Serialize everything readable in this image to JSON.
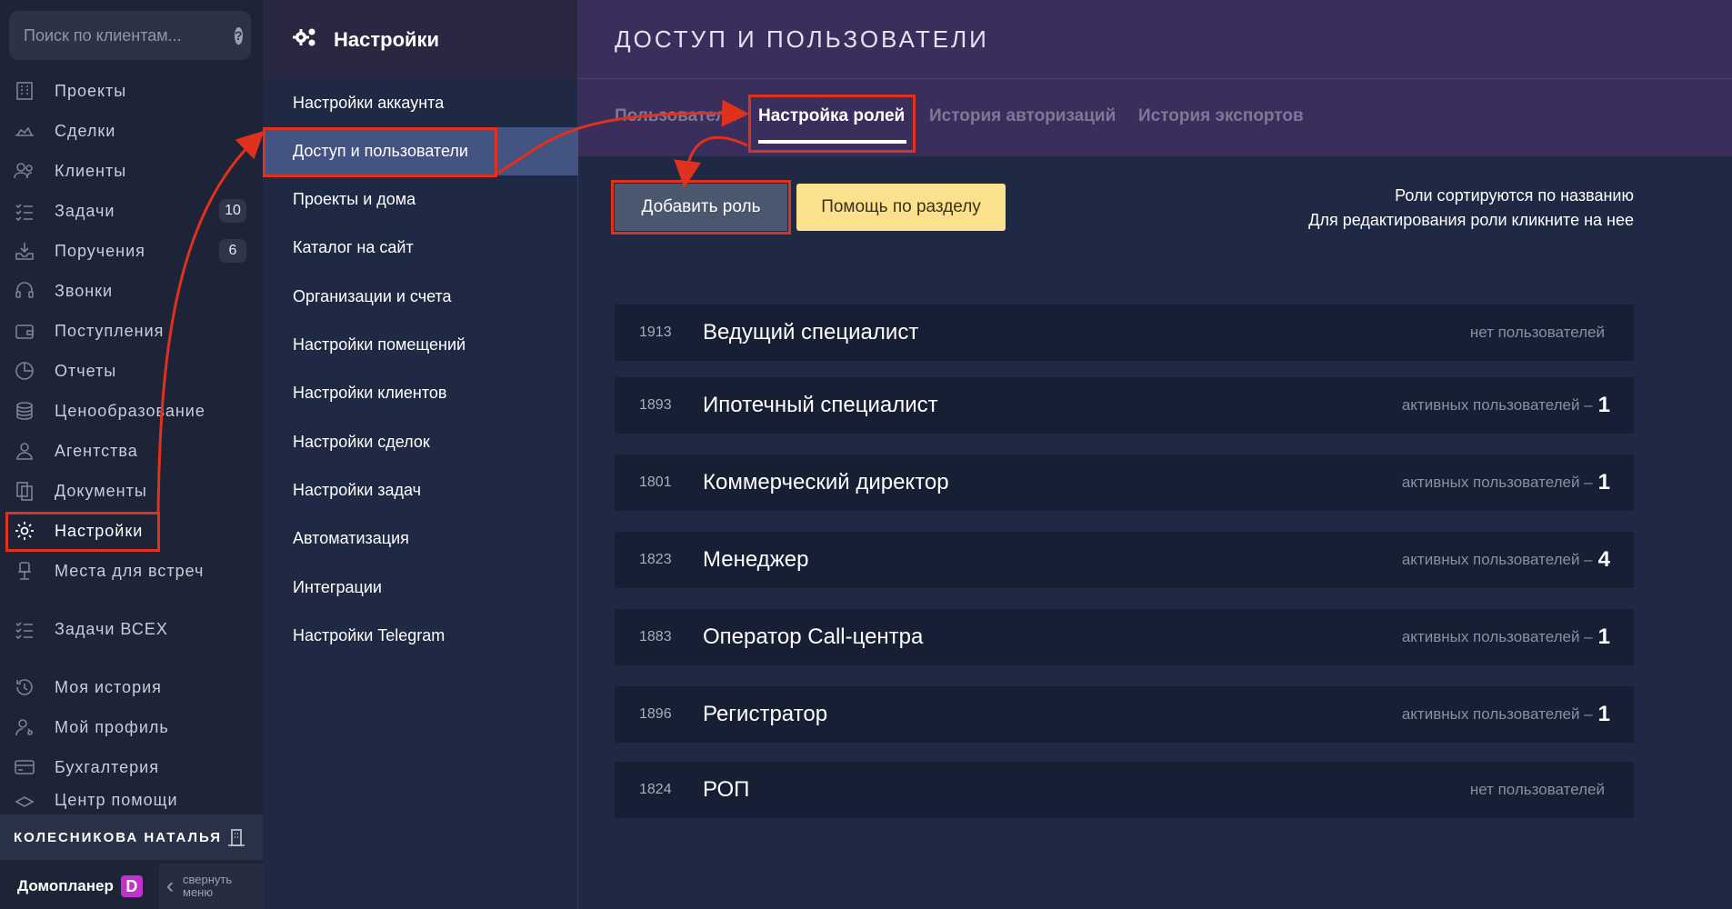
{
  "sidebar": {
    "search_placeholder": "Поиск по клиентам...",
    "items": [
      {
        "label": "Проекты",
        "icon": "building-icon"
      },
      {
        "label": "Сделки",
        "icon": "handshake-icon"
      },
      {
        "label": "Клиенты",
        "icon": "users-icon"
      },
      {
        "label": "Задачи",
        "icon": "checklist-icon",
        "badge": "10"
      },
      {
        "label": "Поручения",
        "icon": "inbox-icon",
        "badge": "6"
      },
      {
        "label": "Звонки",
        "icon": "headset-icon"
      },
      {
        "label": "Поступления",
        "icon": "wallet-icon"
      },
      {
        "label": "Отчеты",
        "icon": "pie-chart-icon"
      },
      {
        "label": "Ценообразование",
        "icon": "coins-icon"
      },
      {
        "label": "Агентства",
        "icon": "agent-icon"
      },
      {
        "label": "Документы",
        "icon": "documents-icon"
      },
      {
        "label": "Настройки",
        "icon": "gear-icon"
      },
      {
        "label": "Места для встреч",
        "icon": "chair-icon"
      },
      {
        "label": "Задачи ВСЕХ",
        "icon": "checklist-icon"
      },
      {
        "label": "Моя история",
        "icon": "history-icon"
      },
      {
        "label": "Мой профиль",
        "icon": "profile-icon"
      },
      {
        "label": "Бухгалтерия",
        "icon": "card-icon"
      },
      {
        "label": "Центр помощи",
        "icon": "help-center-icon"
      }
    ],
    "user_name": "КОЛЕСНИКОВА НАТАЛЬЯ",
    "brand": "Домопланер",
    "brand_logo": "D",
    "collapse_label_1": "свернуть",
    "collapse_label_2": "меню"
  },
  "settings": {
    "title": "Настройки",
    "items": [
      "Настройки аккаунта",
      "Доступ и пользователи",
      "Проекты и дома",
      "Каталог на сайт",
      "Организации и счета",
      "Настройки помещений",
      "Настройки клиентов",
      "Настройки сделок",
      "Настройки задач",
      "Автоматизация",
      "Интеграции",
      "Настройки Telegram"
    ]
  },
  "main": {
    "title": "ДОСТУП И ПОЛЬЗОВАТЕЛИ",
    "tabs": [
      "Пользователи",
      "Настройка ролей",
      "История авторизаций",
      "История экспортов"
    ],
    "add_button": "Добавить роль",
    "help_button": "Помощь по разделу",
    "hint_1": "Роли сортируются по названию",
    "hint_2": "Для редактирования роли кликните на нее",
    "roles": [
      {
        "id": "1913",
        "name": "Ведущий специалист",
        "status": "нет пользователей",
        "count": ""
      },
      {
        "id": "1893",
        "name": "Ипотечный специалист",
        "status": "активных пользователей –",
        "count": "1"
      },
      {
        "id": "1801",
        "name": "Коммерческий директор",
        "status": "активных пользователей –",
        "count": "1"
      },
      {
        "id": "1823",
        "name": "Менеджер",
        "status": "активных пользователей –",
        "count": "4"
      },
      {
        "id": "1883",
        "name": "Оператор Call-центра",
        "status": "активных пользователей –",
        "count": "1"
      },
      {
        "id": "1896",
        "name": "Регистратор",
        "status": "активных пользователей –",
        "count": "1"
      },
      {
        "id": "1824",
        "name": "РОП",
        "status": "нет пользователей",
        "count": ""
      }
    ]
  },
  "colors": {
    "highlight": "#e0301e",
    "active_menu": "#435382",
    "header_purple": "#3a2e5c",
    "help_button": "#fbe18e"
  }
}
